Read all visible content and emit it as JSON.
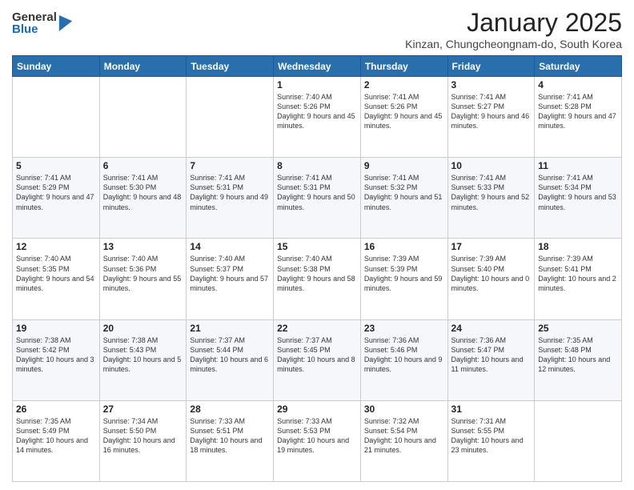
{
  "logo": {
    "general": "General",
    "blue": "Blue"
  },
  "title": "January 2025",
  "location": "Kinzan, Chungcheongnam-do, South Korea",
  "weekdays": [
    "Sunday",
    "Monday",
    "Tuesday",
    "Wednesday",
    "Thursday",
    "Friday",
    "Saturday"
  ],
  "weeks": [
    [
      {
        "day": "",
        "info": ""
      },
      {
        "day": "",
        "info": ""
      },
      {
        "day": "",
        "info": ""
      },
      {
        "day": "1",
        "info": "Sunrise: 7:40 AM\nSunset: 5:26 PM\nDaylight: 9 hours and 45 minutes."
      },
      {
        "day": "2",
        "info": "Sunrise: 7:41 AM\nSunset: 5:26 PM\nDaylight: 9 hours and 45 minutes."
      },
      {
        "day": "3",
        "info": "Sunrise: 7:41 AM\nSunset: 5:27 PM\nDaylight: 9 hours and 46 minutes."
      },
      {
        "day": "4",
        "info": "Sunrise: 7:41 AM\nSunset: 5:28 PM\nDaylight: 9 hours and 47 minutes."
      }
    ],
    [
      {
        "day": "5",
        "info": "Sunrise: 7:41 AM\nSunset: 5:29 PM\nDaylight: 9 hours and 47 minutes."
      },
      {
        "day": "6",
        "info": "Sunrise: 7:41 AM\nSunset: 5:30 PM\nDaylight: 9 hours and 48 minutes."
      },
      {
        "day": "7",
        "info": "Sunrise: 7:41 AM\nSunset: 5:31 PM\nDaylight: 9 hours and 49 minutes."
      },
      {
        "day": "8",
        "info": "Sunrise: 7:41 AM\nSunset: 5:31 PM\nDaylight: 9 hours and 50 minutes."
      },
      {
        "day": "9",
        "info": "Sunrise: 7:41 AM\nSunset: 5:32 PM\nDaylight: 9 hours and 51 minutes."
      },
      {
        "day": "10",
        "info": "Sunrise: 7:41 AM\nSunset: 5:33 PM\nDaylight: 9 hours and 52 minutes."
      },
      {
        "day": "11",
        "info": "Sunrise: 7:41 AM\nSunset: 5:34 PM\nDaylight: 9 hours and 53 minutes."
      }
    ],
    [
      {
        "day": "12",
        "info": "Sunrise: 7:40 AM\nSunset: 5:35 PM\nDaylight: 9 hours and 54 minutes."
      },
      {
        "day": "13",
        "info": "Sunrise: 7:40 AM\nSunset: 5:36 PM\nDaylight: 9 hours and 55 minutes."
      },
      {
        "day": "14",
        "info": "Sunrise: 7:40 AM\nSunset: 5:37 PM\nDaylight: 9 hours and 57 minutes."
      },
      {
        "day": "15",
        "info": "Sunrise: 7:40 AM\nSunset: 5:38 PM\nDaylight: 9 hours and 58 minutes."
      },
      {
        "day": "16",
        "info": "Sunrise: 7:39 AM\nSunset: 5:39 PM\nDaylight: 9 hours and 59 minutes."
      },
      {
        "day": "17",
        "info": "Sunrise: 7:39 AM\nSunset: 5:40 PM\nDaylight: 10 hours and 0 minutes."
      },
      {
        "day": "18",
        "info": "Sunrise: 7:39 AM\nSunset: 5:41 PM\nDaylight: 10 hours and 2 minutes."
      }
    ],
    [
      {
        "day": "19",
        "info": "Sunrise: 7:38 AM\nSunset: 5:42 PM\nDaylight: 10 hours and 3 minutes."
      },
      {
        "day": "20",
        "info": "Sunrise: 7:38 AM\nSunset: 5:43 PM\nDaylight: 10 hours and 5 minutes."
      },
      {
        "day": "21",
        "info": "Sunrise: 7:37 AM\nSunset: 5:44 PM\nDaylight: 10 hours and 6 minutes."
      },
      {
        "day": "22",
        "info": "Sunrise: 7:37 AM\nSunset: 5:45 PM\nDaylight: 10 hours and 8 minutes."
      },
      {
        "day": "23",
        "info": "Sunrise: 7:36 AM\nSunset: 5:46 PM\nDaylight: 10 hours and 9 minutes."
      },
      {
        "day": "24",
        "info": "Sunrise: 7:36 AM\nSunset: 5:47 PM\nDaylight: 10 hours and 11 minutes."
      },
      {
        "day": "25",
        "info": "Sunrise: 7:35 AM\nSunset: 5:48 PM\nDaylight: 10 hours and 12 minutes."
      }
    ],
    [
      {
        "day": "26",
        "info": "Sunrise: 7:35 AM\nSunset: 5:49 PM\nDaylight: 10 hours and 14 minutes."
      },
      {
        "day": "27",
        "info": "Sunrise: 7:34 AM\nSunset: 5:50 PM\nDaylight: 10 hours and 16 minutes."
      },
      {
        "day": "28",
        "info": "Sunrise: 7:33 AM\nSunset: 5:51 PM\nDaylight: 10 hours and 18 minutes."
      },
      {
        "day": "29",
        "info": "Sunrise: 7:33 AM\nSunset: 5:53 PM\nDaylight: 10 hours and 19 minutes."
      },
      {
        "day": "30",
        "info": "Sunrise: 7:32 AM\nSunset: 5:54 PM\nDaylight: 10 hours and 21 minutes."
      },
      {
        "day": "31",
        "info": "Sunrise: 7:31 AM\nSunset: 5:55 PM\nDaylight: 10 hours and 23 minutes."
      },
      {
        "day": "",
        "info": ""
      }
    ]
  ]
}
